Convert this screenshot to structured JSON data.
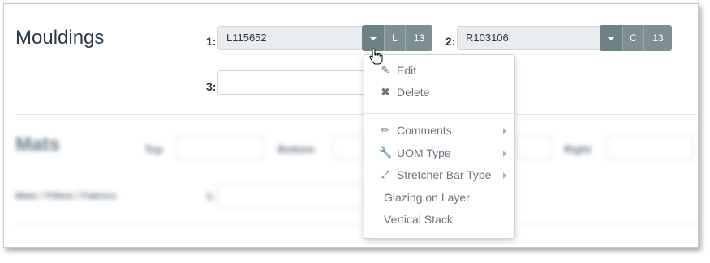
{
  "section": {
    "title": "Mouldings"
  },
  "mouldings": [
    {
      "num": "1:",
      "value": "L115652",
      "type_btn": "L",
      "count_btn": "13"
    },
    {
      "num": "2:",
      "value": "R103106",
      "type_btn": "C",
      "count_btn": "13"
    },
    {
      "num": "3:",
      "value": ""
    }
  ],
  "mats": {
    "title": "Mats",
    "top_label": "Top",
    "bottom_label": "Bottom",
    "right_label": "Right",
    "mats_label": "Mats / Fillets / Fabrics",
    "num": "1:"
  },
  "context_menu": {
    "items": [
      {
        "label": "Edit",
        "icon": "edit-icon",
        "submenu": false
      },
      {
        "label": "Delete",
        "icon": "close-icon",
        "submenu": false
      },
      {
        "label": "Comments",
        "icon": "pencil-icon",
        "submenu": true
      },
      {
        "label": "UOM Type",
        "icon": "wrench-icon",
        "submenu": true
      },
      {
        "label": "Stretcher Bar Type",
        "icon": "expand-icon",
        "submenu": true
      },
      {
        "label": "Glazing on Layer",
        "icon": "",
        "submenu": false
      },
      {
        "label": "Vertical Stack",
        "icon": "",
        "submenu": false
      }
    ]
  },
  "colors": {
    "button": "#7d8f93",
    "title": "#2b3a4a",
    "menu_text": "#6b7580"
  }
}
